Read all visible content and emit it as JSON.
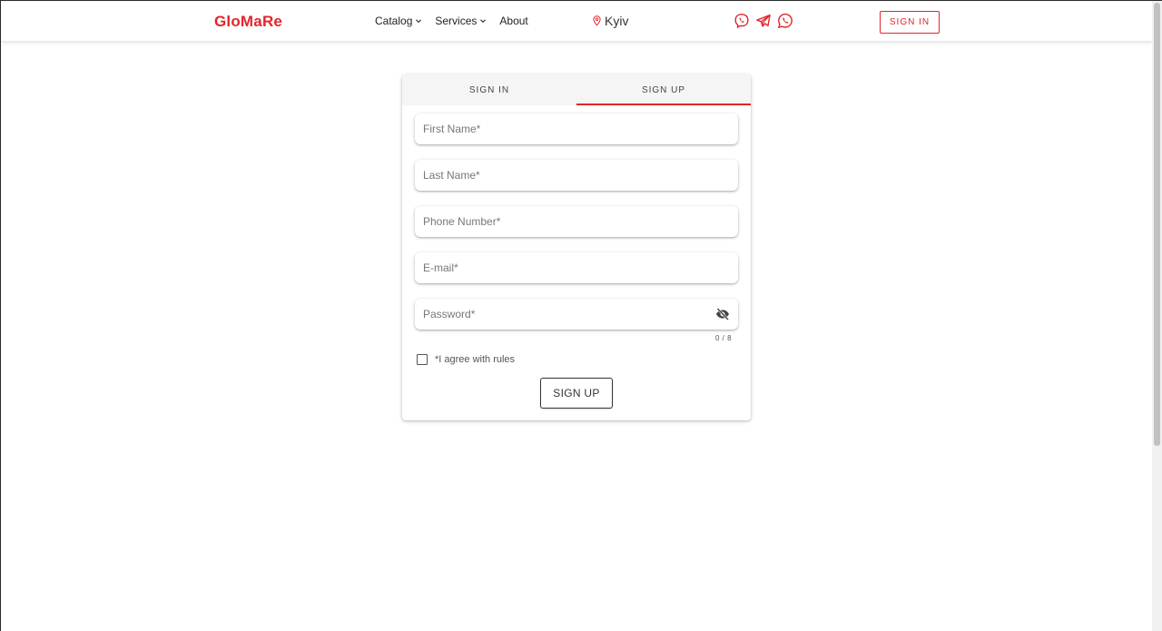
{
  "header": {
    "logo": "GloMaRe",
    "nav": [
      {
        "label": "Catalog",
        "has_dropdown": true
      },
      {
        "label": "Services",
        "has_dropdown": true
      },
      {
        "label": "About",
        "has_dropdown": false
      }
    ],
    "city": "Kyiv",
    "city_icon": "location-pin-icon",
    "socials": [
      "viber-icon",
      "telegram-icon",
      "whatsapp-icon"
    ],
    "signin_label": "SIGN IN"
  },
  "auth": {
    "tabs": [
      {
        "label": "SIGN IN",
        "active": false
      },
      {
        "label": "SIGN UP",
        "active": true
      }
    ],
    "fields": {
      "first_name": {
        "placeholder": "First Name*",
        "value": ""
      },
      "last_name": {
        "placeholder": "Last Name*",
        "value": ""
      },
      "phone": {
        "placeholder": "Phone Number*",
        "value": ""
      },
      "email": {
        "placeholder": "E-mail*",
        "value": ""
      },
      "password": {
        "placeholder": "Password*",
        "value": "",
        "icon": "eye-off-icon"
      }
    },
    "password_counter": "0 / 8",
    "agree_label": "*I agree with rules",
    "agree_checked": false,
    "submit_label": "SIGN UP"
  },
  "colors": {
    "brand": "#e2252b",
    "text": "#333333"
  }
}
